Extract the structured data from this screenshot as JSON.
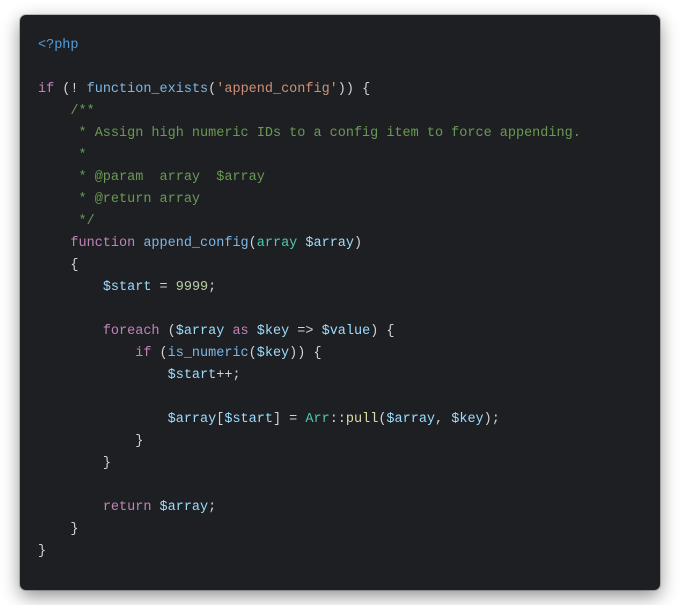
{
  "code": {
    "open_tag": "<?php",
    "kw_if": "if",
    "bang": "!",
    "fn_function_exists": "function_exists",
    "str_append_config": "'append_config'",
    "doc_open": "/**",
    "doc_desc": " * Assign high numeric IDs to a config item to force appending.",
    "doc_blank": " *",
    "doc_param": " * @param  array  $array",
    "doc_return": " * @return array",
    "doc_close": " */",
    "kw_function": "function",
    "fn_append_config": "append_config",
    "type_array": "array",
    "var_array": "$array",
    "var_start": "$start",
    "num_9999": "9999",
    "kw_foreach": "foreach",
    "kw_as": "as",
    "var_key": "$key",
    "arrow": "=>",
    "var_value": "$value",
    "fn_is_numeric": "is_numeric",
    "incr": "++",
    "class_arr": "Arr",
    "dcolon": "::",
    "method_pull": "pull",
    "kw_return": "return",
    "brace_open": "{",
    "brace_close": "}",
    "paren_open": "(",
    "paren_close": ")",
    "bracket_open": "[",
    "bracket_close": "]",
    "semi": ";",
    "comma": ",",
    "eq": "=",
    "sp": " "
  }
}
